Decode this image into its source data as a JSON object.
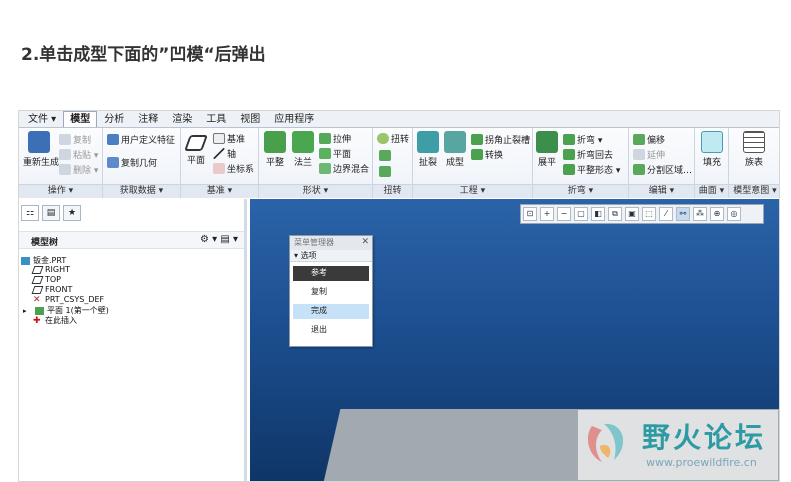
{
  "heading": "2.单击成型下面的”凹模“后弹出",
  "tabs": [
    "文件 ▾",
    "模型",
    "分析",
    "注释",
    "渲染",
    "工具",
    "视图",
    "应用程序"
  ],
  "ribbon": {
    "groups": [
      "操作 ▾",
      "获取数据 ▾",
      "基准 ▾",
      "形状 ▾",
      "扭转",
      "工程 ▾",
      "折弯 ▾",
      "编辑 ▾",
      "曲面 ▾",
      "模型意图 ▾"
    ],
    "ops": {
      "regen": "重新生成",
      "copy": "复制",
      "paste": "粘贴 ▾",
      "delete": "删除 ▾"
    },
    "getdata": {
      "udf": "用户定义特征",
      "copygeom": "复制几何"
    },
    "datum": {
      "plane": "平面",
      "axis": "轴",
      "point": "基准",
      "csys": "坐标系"
    },
    "shape": {
      "flat": "平整",
      "flange": "法兰",
      "extrude": "拉伸",
      "planar": "平面",
      "blend": "边界混合"
    },
    "twist": {
      "twist": "扭转"
    },
    "eng": {
      "rip": "拐角止裂槽",
      "convert": "转换",
      "rip2": "扯裂",
      "form": "成型"
    },
    "bend": {
      "bend": "折弯 ▾",
      "unbend": "展平",
      "bendback": "折弯回去",
      "flatpattern": "平整形态 ▾"
    },
    "edit": {
      "offset": "偏移",
      "extend": "延伸",
      "split": "分割区域…"
    },
    "surf": {
      "fill": "填充"
    },
    "intent": {
      "table": "族表"
    }
  },
  "tree": {
    "header": "模型树",
    "nodes": [
      "钣金.PRT",
      "RIGHT",
      "TOP",
      "FRONT",
      "PRT_CSYS_DEF",
      "平面 1(第一个壁)",
      "在此插入"
    ]
  },
  "menu_manager": {
    "title": "菜单管理器",
    "close": "✕",
    "section": "选项",
    "items": [
      "参考",
      "复制",
      "完成",
      "退出"
    ]
  },
  "watermark": {
    "cn": "野火论坛",
    "url": "www.proewildfire.cn"
  },
  "colors": {
    "accent": "#1c4f90",
    "watermark": "#2e9aa4"
  }
}
